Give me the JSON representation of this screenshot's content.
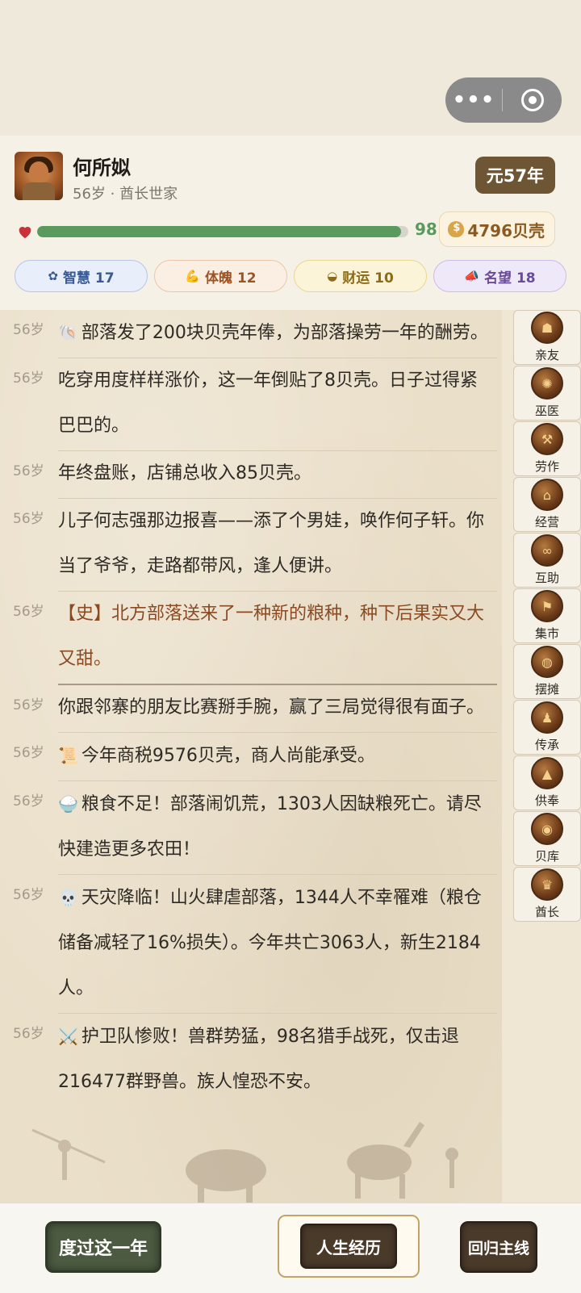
{
  "player": {
    "name": "何所姒",
    "subtitle": "56岁 · 酋长世家",
    "year": "元57年",
    "health": 98,
    "health_fraction": 0.98,
    "money": "4796贝壳"
  },
  "stats": [
    {
      "label": "智慧 17",
      "icon": "brain-icon"
    },
    {
      "label": "体魄 12",
      "icon": "muscle-icon"
    },
    {
      "label": "财运 10",
      "icon": "gold-ingot-icon"
    },
    {
      "label": "名望 18",
      "icon": "megaphone-icon"
    }
  ],
  "log": [
    {
      "age": "56岁",
      "emoji": "🐚",
      "text": "部落发了200块贝壳年俸，为部落操劳一年的酬劳。"
    },
    {
      "age": "56岁",
      "emoji": "",
      "text": "吃穿用度样样涨价，这一年倒贴了8贝壳。日子过得紧巴巴的。"
    },
    {
      "age": "56岁",
      "emoji": "",
      "text": "年终盘账，店铺总收入85贝壳。"
    },
    {
      "age": "56岁",
      "emoji": "",
      "text": "儿子何志强那边报喜——添了个男娃，唤作何子轩。你当了爷爷，走路都带风，逢人便讲。"
    },
    {
      "age": "56岁",
      "emoji": "",
      "text": "【史】北方部落送来了一种新的粮种，种下后果实又大又甜。"
    },
    {
      "age": "56岁",
      "emoji": "",
      "text": "你跟邻寨的朋友比赛掰手腕，赢了三局觉得很有面子。"
    },
    {
      "age": "56岁",
      "emoji": "📜",
      "text": "今年商税9576贝壳，商人尚能承受。"
    },
    {
      "age": "56岁",
      "emoji": "🍚",
      "text": "粮食不足！部落闹饥荒，1303人因缺粮死亡。请尽快建造更多农田！"
    },
    {
      "age": "56岁",
      "emoji": "💀",
      "text": "天灾降临！山火肆虐部落，1344人不幸罹难（粮仓储备减轻了16%损失）。今年共亡3063人，新生2184人。"
    },
    {
      "age": "56岁",
      "emoji": "⚔️",
      "text": "护卫队惨败！兽群势猛，98名猎手战死，仅击退216477群野兽。族人惶恐不安。"
    }
  ],
  "sidenav": [
    {
      "label": "亲友",
      "icon": "family-icon"
    },
    {
      "label": "巫医",
      "icon": "shaman-icon"
    },
    {
      "label": "劳作",
      "icon": "tools-icon"
    },
    {
      "label": "经营",
      "icon": "shop-icon"
    },
    {
      "label": "互助",
      "icon": "handshake-icon"
    },
    {
      "label": "集市",
      "icon": "market-icon"
    },
    {
      "label": "摆摊",
      "icon": "stall-icon"
    },
    {
      "label": "传承",
      "icon": "heritage-icon"
    },
    {
      "label": "供奉",
      "icon": "altar-icon"
    },
    {
      "label": "贝库",
      "icon": "treasury-icon"
    },
    {
      "label": "酋长",
      "icon": "chief-icon"
    }
  ],
  "bottom": {
    "pass_year": "度过这一年",
    "life_history": "人生经历",
    "main_line": "回归主线"
  },
  "colors": {
    "health": "#5a9a5c",
    "year_badge": "#6e5533",
    "history_text": "#8a4a22"
  }
}
